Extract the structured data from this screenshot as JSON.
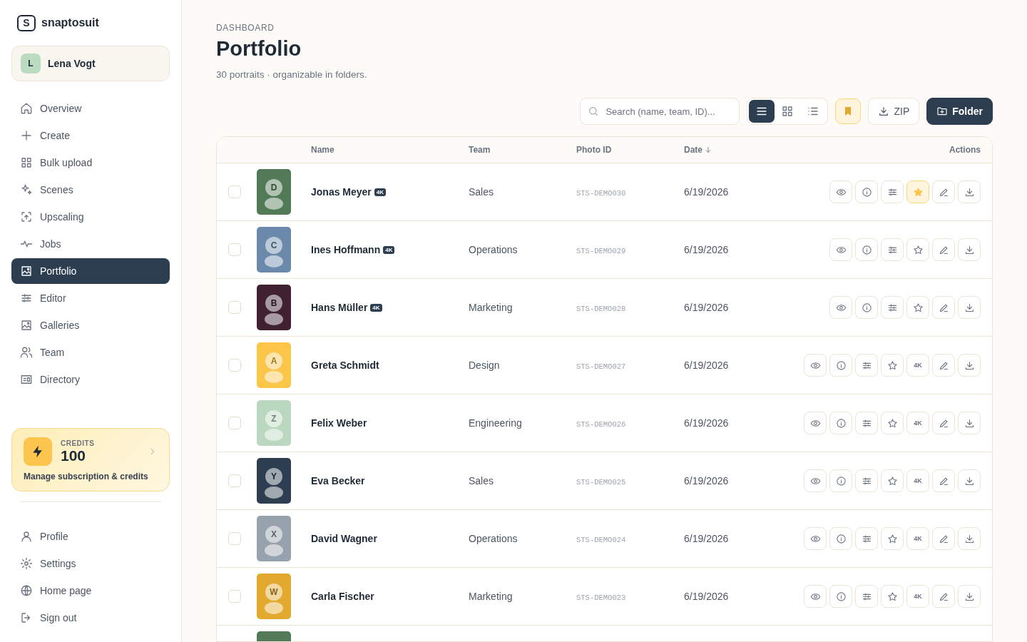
{
  "brand": {
    "mark": "S",
    "name": "snaptosuit"
  },
  "user": {
    "initial": "L",
    "name": "Lena Vogt"
  },
  "nav": {
    "items": [
      {
        "label": "Overview",
        "selected": false
      },
      {
        "label": "Create",
        "selected": false
      },
      {
        "label": "Bulk upload",
        "selected": false
      },
      {
        "label": "Scenes",
        "selected": false
      },
      {
        "label": "Upscaling",
        "selected": false
      },
      {
        "label": "Jobs",
        "selected": false
      },
      {
        "label": "Portfolio",
        "selected": true
      },
      {
        "label": "Editor",
        "selected": false
      },
      {
        "label": "Galleries",
        "selected": false
      },
      {
        "label": "Team",
        "selected": false
      },
      {
        "label": "Directory",
        "selected": false
      }
    ]
  },
  "credits": {
    "label": "CREDITS",
    "value": "100",
    "link": "Manage subscription & credits"
  },
  "account_menu": [
    {
      "label": "Profile"
    },
    {
      "label": "Settings"
    },
    {
      "label": "Home page"
    },
    {
      "label": "Sign out"
    }
  ],
  "header": {
    "eyebrow": "DASHBOARD",
    "title": "Portfolio",
    "subtitle": "30 portraits · organizable in folders."
  },
  "toolbar": {
    "search": {
      "placeholder": "Search (name, team, ID)..."
    },
    "view_modes": [
      {
        "selected": true
      },
      {
        "selected": false
      },
      {
        "selected": false
      }
    ],
    "bookmark_filter": {
      "on": true
    },
    "zip_button": "ZIP",
    "folder_button": "Folder"
  },
  "table": {
    "columns": [
      "Name",
      "Team",
      "Photo ID",
      "Date",
      "Actions"
    ],
    "rows": [
      {
        "checked": false,
        "color": "#527a56",
        "initial": "D",
        "name": "Jonas Meyer",
        "badge": "4K",
        "team": "Sales",
        "photo_id": "STS-DEMO030",
        "date": "6/19/2026",
        "favorite": true
      },
      {
        "checked": false,
        "color": "#6b8aab",
        "initial": "C",
        "name": "Ines Hoffmann",
        "badge": "4K",
        "team": "Operations",
        "photo_id": "STS-DEMO029",
        "date": "6/19/2026",
        "favorite": false
      },
      {
        "checked": false,
        "color": "#3f2130",
        "initial": "B",
        "name": "Hans Müller",
        "badge": "4K",
        "team": "Marketing",
        "photo_id": "STS-DEMO028",
        "date": "6/19/2026",
        "favorite": false
      },
      {
        "checked": false,
        "color": "#fbc54a",
        "initial": "A",
        "name": "Greta Schmidt",
        "upscale_label": "4K",
        "team": "Design",
        "photo_id": "STS-DEMO027",
        "date": "6/19/2026",
        "favorite": false
      },
      {
        "checked": false,
        "color": "#b9d8bf",
        "initial": "Z",
        "name": "Felix Weber",
        "upscale_label": "4K",
        "team": "Engineering",
        "photo_id": "STS-DEMO026",
        "date": "6/19/2026",
        "favorite": false
      },
      {
        "checked": false,
        "color": "#2d3e50",
        "initial": "Y",
        "name": "Eva Becker",
        "upscale_label": "4K",
        "team": "Sales",
        "photo_id": "STS-DEMO025",
        "date": "6/19/2026",
        "favorite": false
      },
      {
        "checked": false,
        "color": "#98a2ae",
        "initial": "X",
        "name": "David Wagner",
        "upscale_label": "4K",
        "team": "Operations",
        "photo_id": "STS-DEMO024",
        "date": "6/19/2026",
        "favorite": false
      },
      {
        "checked": false,
        "color": "#e3a92f",
        "initial": "W",
        "name": "Carla Fischer",
        "upscale_label": "4K",
        "team": "Marketing",
        "photo_id": "STS-DEMO023",
        "date": "6/19/2026",
        "favorite": false
      },
      {
        "color": "#527a56"
      }
    ]
  }
}
